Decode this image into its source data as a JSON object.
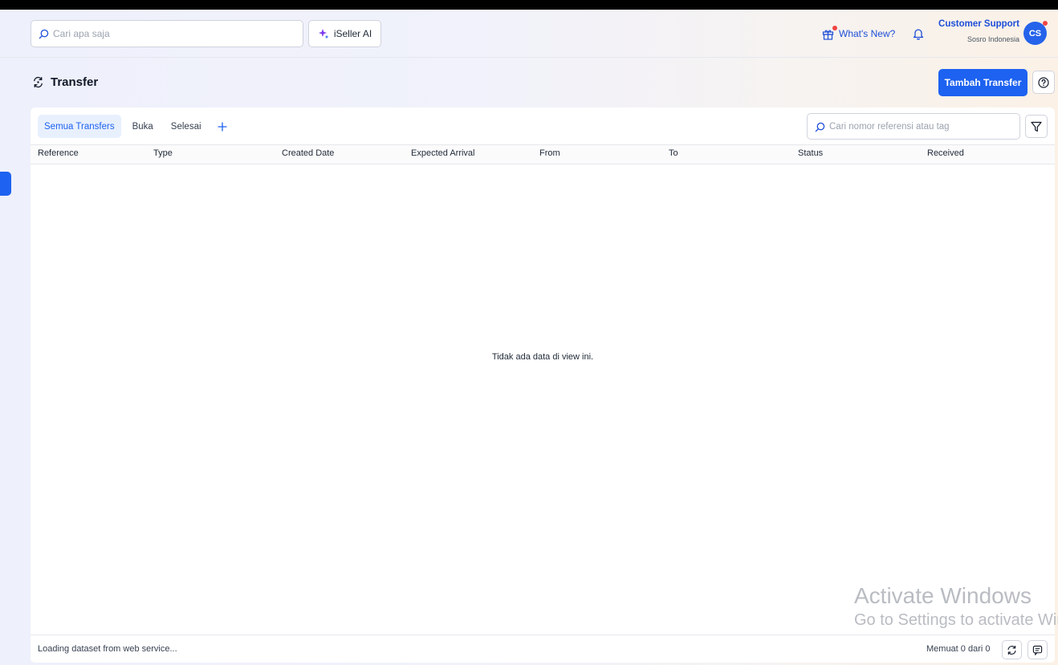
{
  "header": {
    "search_placeholder": "Cari apa saja",
    "ai_label": "iSeller AI",
    "whats_new_label": "What's New?",
    "user_name": "Customer Support",
    "user_org": "Sosro Indonesia",
    "avatar_initials": "CS"
  },
  "page": {
    "title": "Transfer",
    "add_button_label": "Tambah Transfer"
  },
  "tabs": [
    {
      "label": "Semua Transfers",
      "active": true
    },
    {
      "label": "Buka",
      "active": false
    },
    {
      "label": "Selesai",
      "active": false
    }
  ],
  "table": {
    "search_placeholder": "Cari nomor referensi atau tag",
    "columns": [
      "Reference",
      "Type",
      "Created Date",
      "Expected Arrival",
      "From",
      "To",
      "Status",
      "Received"
    ],
    "empty_message": "Tidak ada data di view ini."
  },
  "footer": {
    "status_text": "Loading dataset from web service...",
    "count_text": "Memuat 0 dari 0"
  },
  "watermark": {
    "line1": "Activate Windows",
    "line2": "Go to Settings to activate Windows."
  },
  "colors": {
    "accent": "#1d62f0",
    "link": "#1d4ed8",
    "notification": "#ef4444"
  }
}
